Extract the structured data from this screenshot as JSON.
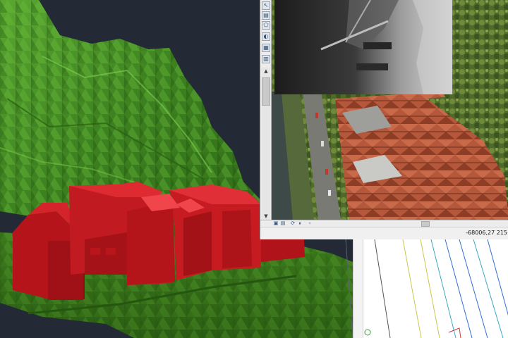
{
  "app": {
    "viewport_3d": {
      "background": "#232a35",
      "terrain_color": "#3f8a20",
      "building_color": "#b5141a"
    },
    "ortho_window": {
      "toolbar_icons": [
        "cursor-icon",
        "layer-icon",
        "polygon-icon",
        "color-icon",
        "grid-icon",
        "table-icon"
      ],
      "scroll_up_glyph": "▲",
      "scroll_down_glyph": "▼",
      "status_icons": [
        "image-icon",
        "save-icon",
        "refresh-icon",
        "pause-icon",
        "arrow-left-icon"
      ],
      "status_glyphs": [
        "▣",
        "▤",
        "⟳",
        "⏸",
        "‹"
      ],
      "coordinates": "-68006,27  215"
    },
    "drawing_panel": {
      "line_colors": [
        "#2f6fd6",
        "#c9c94a",
        "#3aa7c2",
        "#555555"
      ]
    }
  }
}
